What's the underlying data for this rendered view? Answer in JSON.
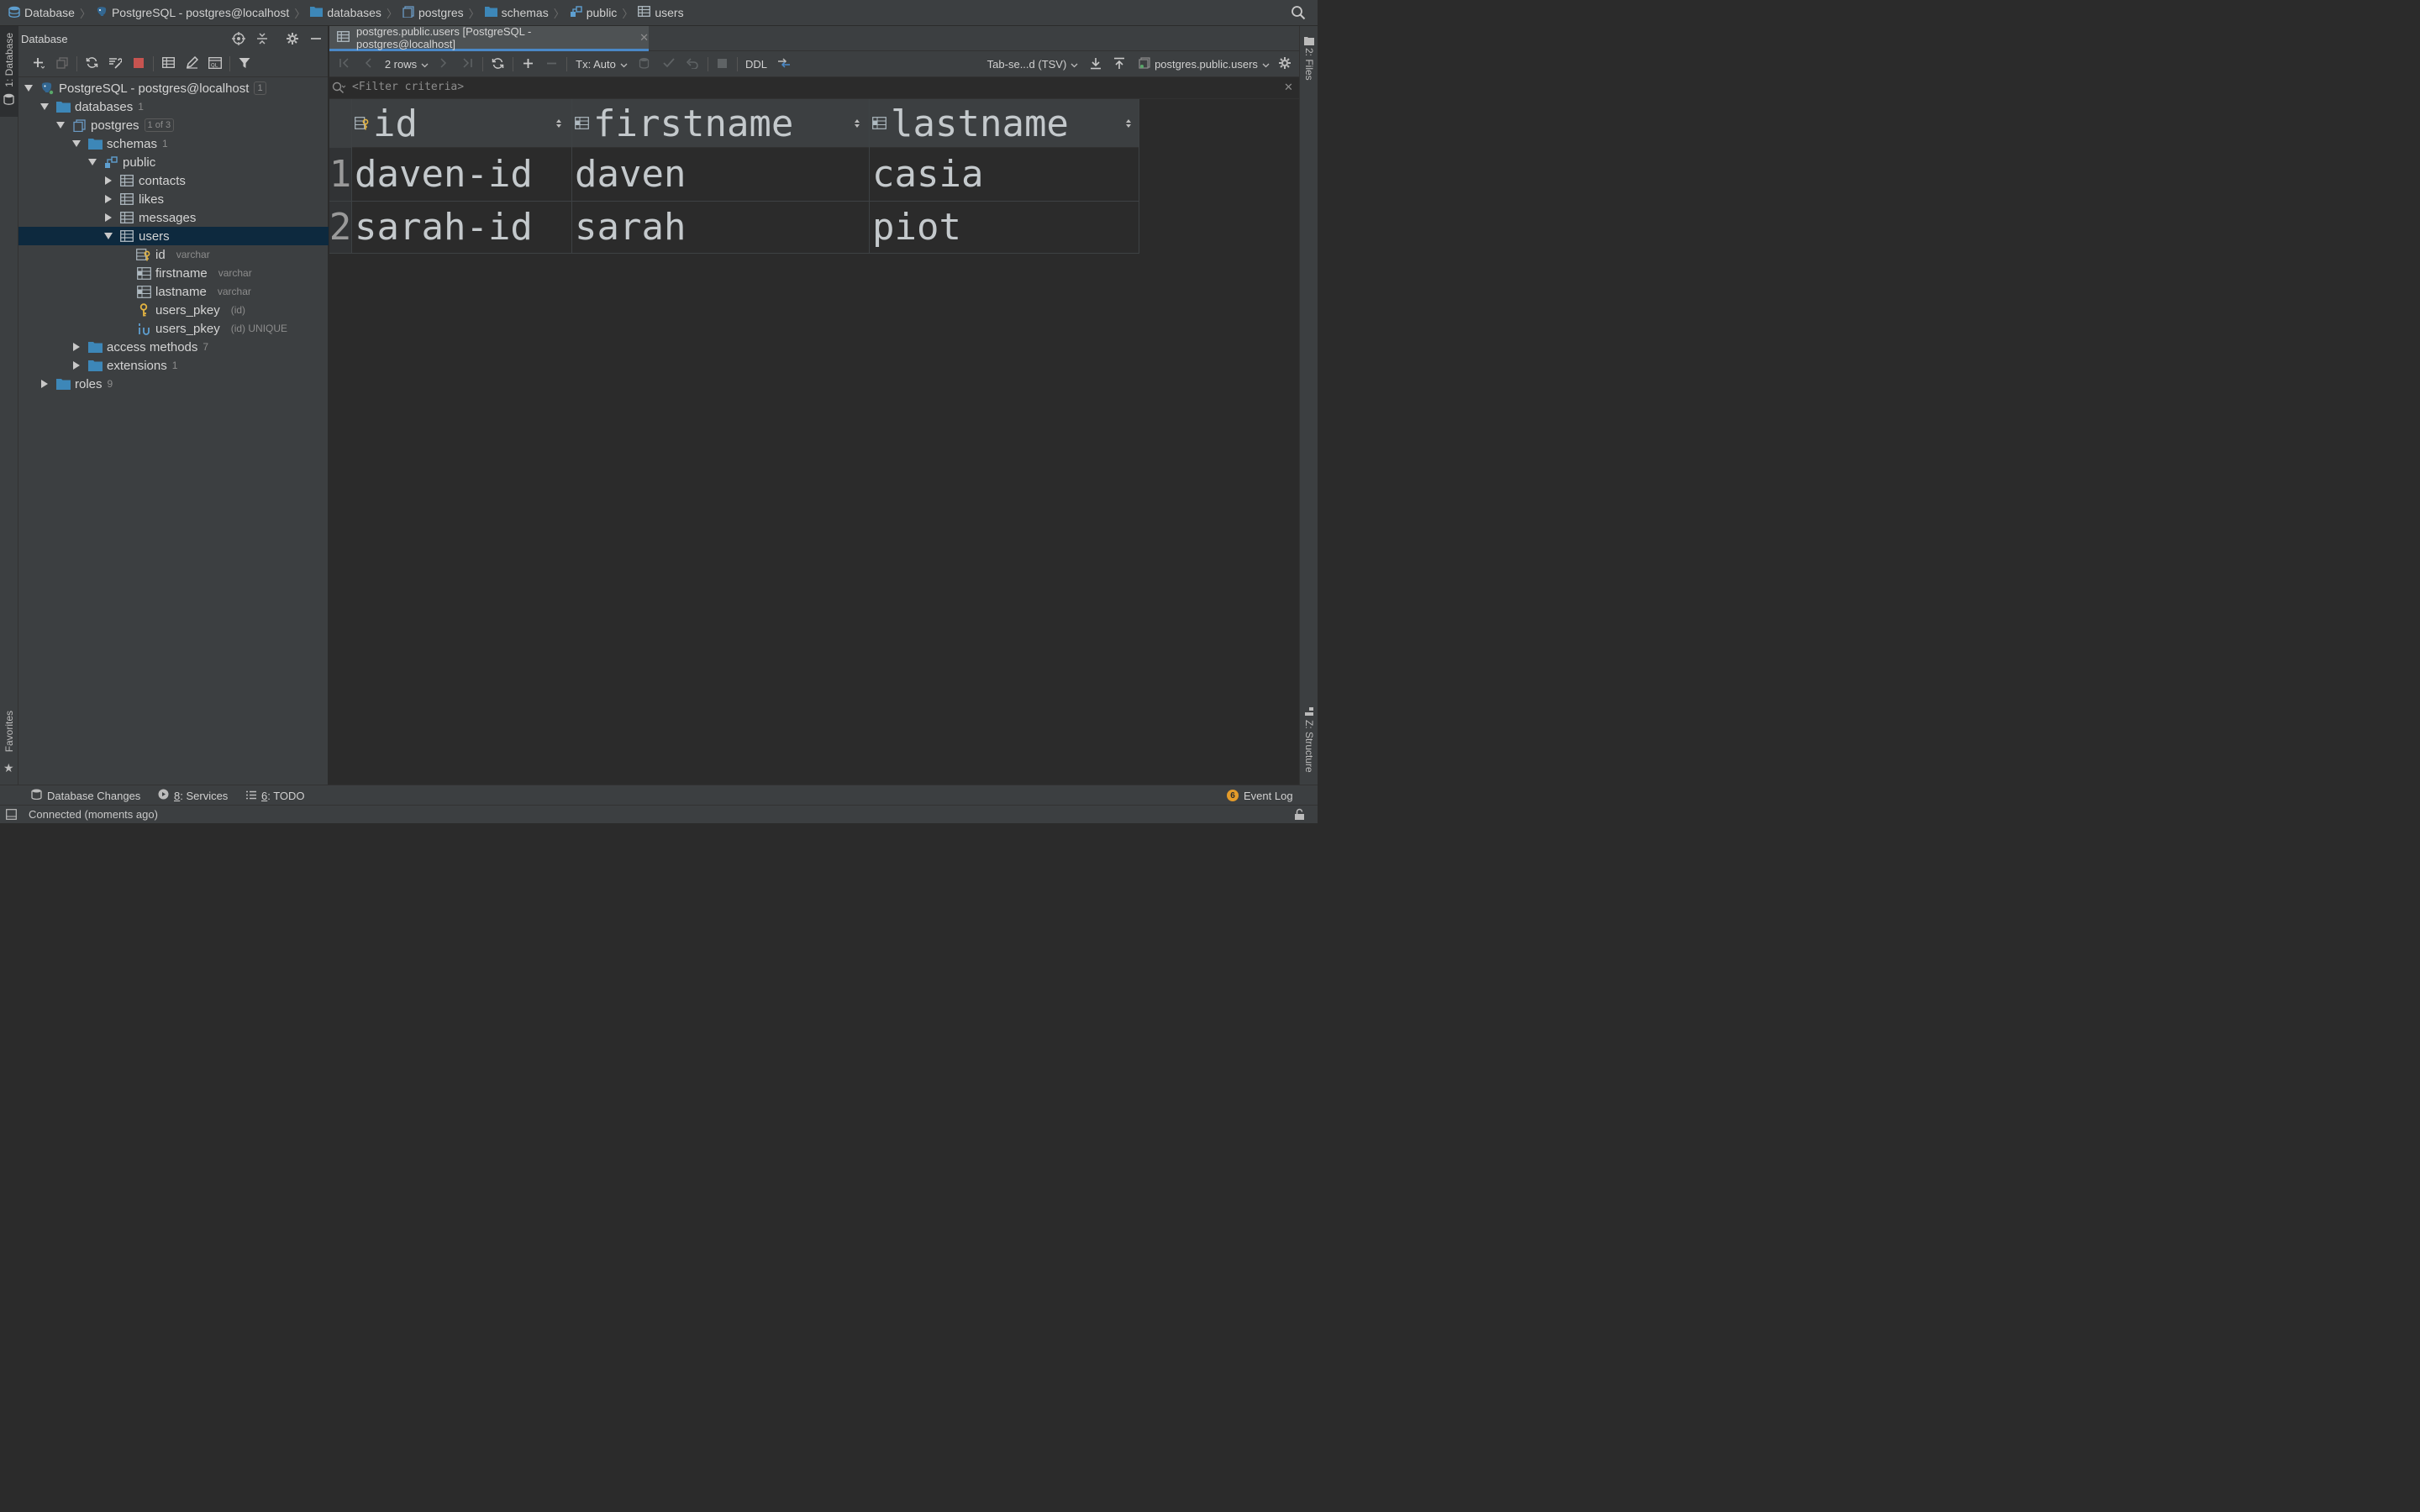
{
  "breadcrumbs": [
    {
      "label": "Database",
      "icon": "database-icon"
    },
    {
      "label": "PostgreSQL - postgres@localhost",
      "icon": "postgresql-icon"
    },
    {
      "label": "databases",
      "icon": "folder-icon"
    },
    {
      "label": "postgres",
      "icon": "database-schema-icon"
    },
    {
      "label": "schemas",
      "icon": "folder-icon"
    },
    {
      "label": "public",
      "icon": "schema-icon"
    },
    {
      "label": "users",
      "icon": "table-icon"
    }
  ],
  "left_strip": {
    "database_tab": "1: Database",
    "favorites_tab": "Favorites"
  },
  "right_strip": {
    "files_tab": "2: Files",
    "structure_tab": "Z: Structure"
  },
  "db_panel": {
    "title": "Database",
    "tree": {
      "root": {
        "label": "PostgreSQL - postgres@localhost",
        "count": "1"
      },
      "databases": {
        "label": "databases",
        "count": "1"
      },
      "postgres": {
        "label": "postgres",
        "count": "1 of 3"
      },
      "schemas": {
        "label": "schemas",
        "count": "1"
      },
      "public": {
        "label": "public"
      },
      "contacts": {
        "label": "contacts"
      },
      "likes": {
        "label": "likes"
      },
      "messages": {
        "label": "messages"
      },
      "users": {
        "label": "users"
      },
      "col_id": {
        "label": "id",
        "type": "varchar"
      },
      "col_firstname": {
        "label": "firstname",
        "type": "varchar"
      },
      "col_lastname": {
        "label": "lastname",
        "type": "varchar"
      },
      "pkey": {
        "label": "users_pkey",
        "detail": "(id)"
      },
      "pkey_index": {
        "label": "users_pkey",
        "detail": "(id) UNIQUE"
      },
      "access_methods": {
        "label": "access methods",
        "count": "7"
      },
      "extensions": {
        "label": "extensions",
        "count": "1"
      },
      "roles": {
        "label": "roles",
        "count": "9"
      }
    }
  },
  "editor": {
    "tab_label": "postgres.public.users [PostgreSQL - postgres@localhost]",
    "rows_label": "2 rows",
    "tx_label": "Tx: Auto",
    "ddl_label": "DDL",
    "export_format": "Tab-se...d (TSV)",
    "table_selector": "postgres.public.users",
    "filter_placeholder": "<Filter criteria>"
  },
  "grid": {
    "columns": [
      "id",
      "firstname",
      "lastname"
    ],
    "rows": [
      {
        "num": "1",
        "cells": [
          "daven-id",
          "daven",
          "casia"
        ]
      },
      {
        "num": "2",
        "cells": [
          "sarah-id",
          "sarah",
          "piot"
        ]
      }
    ]
  },
  "bottom_tools": {
    "db_changes": "Database Changes",
    "services_num": "8",
    "services_label": ": Services",
    "todo_num": "6",
    "todo_label": ": TODO",
    "event_count": "6",
    "event_log": "Event Log"
  },
  "status": {
    "text": "Connected (moments ago)"
  },
  "colors": {
    "accent": "#4a88c7",
    "folder": "#3d87b8",
    "key": "#e3b341",
    "stop": "#c75450",
    "selection": "#0d293e"
  }
}
